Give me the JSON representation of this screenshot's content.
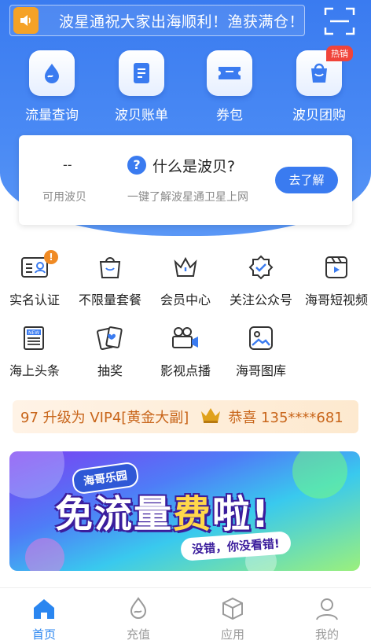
{
  "notice": {
    "text": "波星通祝大家出海顺利！渔获满仓！"
  },
  "top_nav": [
    {
      "label": "流量查询",
      "icon": "water-drop-icon"
    },
    {
      "label": "波贝账单",
      "icon": "bill-icon"
    },
    {
      "label": "券包",
      "icon": "coupon-icon"
    },
    {
      "label": "波贝团购",
      "icon": "shopping-bag-icon",
      "badge": "热销"
    }
  ],
  "points_card": {
    "balance": "--",
    "balance_label": "可用波贝",
    "title": "什么是波贝?",
    "description": "一键了解波星通卫星上网",
    "button": "去了解"
  },
  "services": [
    {
      "label": "实名认证",
      "icon": "id-card-icon",
      "badge": "!"
    },
    {
      "label": "不限量套餐",
      "icon": "bag-icon"
    },
    {
      "label": "会员中心",
      "icon": "crown-icon"
    },
    {
      "label": "关注公众号",
      "icon": "verified-badge-icon"
    },
    {
      "label": "海哥短视频",
      "icon": "video-player-icon"
    },
    {
      "label": "海上头条",
      "icon": "newspaper-icon"
    },
    {
      "label": "抽奖",
      "icon": "cards-icon"
    },
    {
      "label": "影视点播",
      "icon": "film-camera-icon"
    },
    {
      "label": "海哥图库",
      "icon": "gallery-icon"
    }
  ],
  "ticker": {
    "left_text": "97 升级为 VIP4[黄金大副]",
    "right_text": "恭喜 135****681"
  },
  "banner": {
    "badge": "海哥乐园",
    "headline_1": "免流量",
    "headline_2": "费",
    "headline_3": "啦!",
    "sub": "没错，你没看错!"
  },
  "tab_bar": [
    {
      "label": "首页",
      "icon": "home-icon",
      "active": true
    },
    {
      "label": "充值",
      "icon": "recharge-icon",
      "active": false
    },
    {
      "label": "应用",
      "icon": "apps-cube-icon",
      "active": false
    },
    {
      "label": "我的",
      "icon": "profile-icon",
      "active": false
    }
  ],
  "colors": {
    "primary": "#3a7bf0",
    "active_tab": "#2a86f0",
    "inactive_tab": "#9a9a9a",
    "ticker_text": "#c8651a",
    "hot": "#f0443a"
  }
}
